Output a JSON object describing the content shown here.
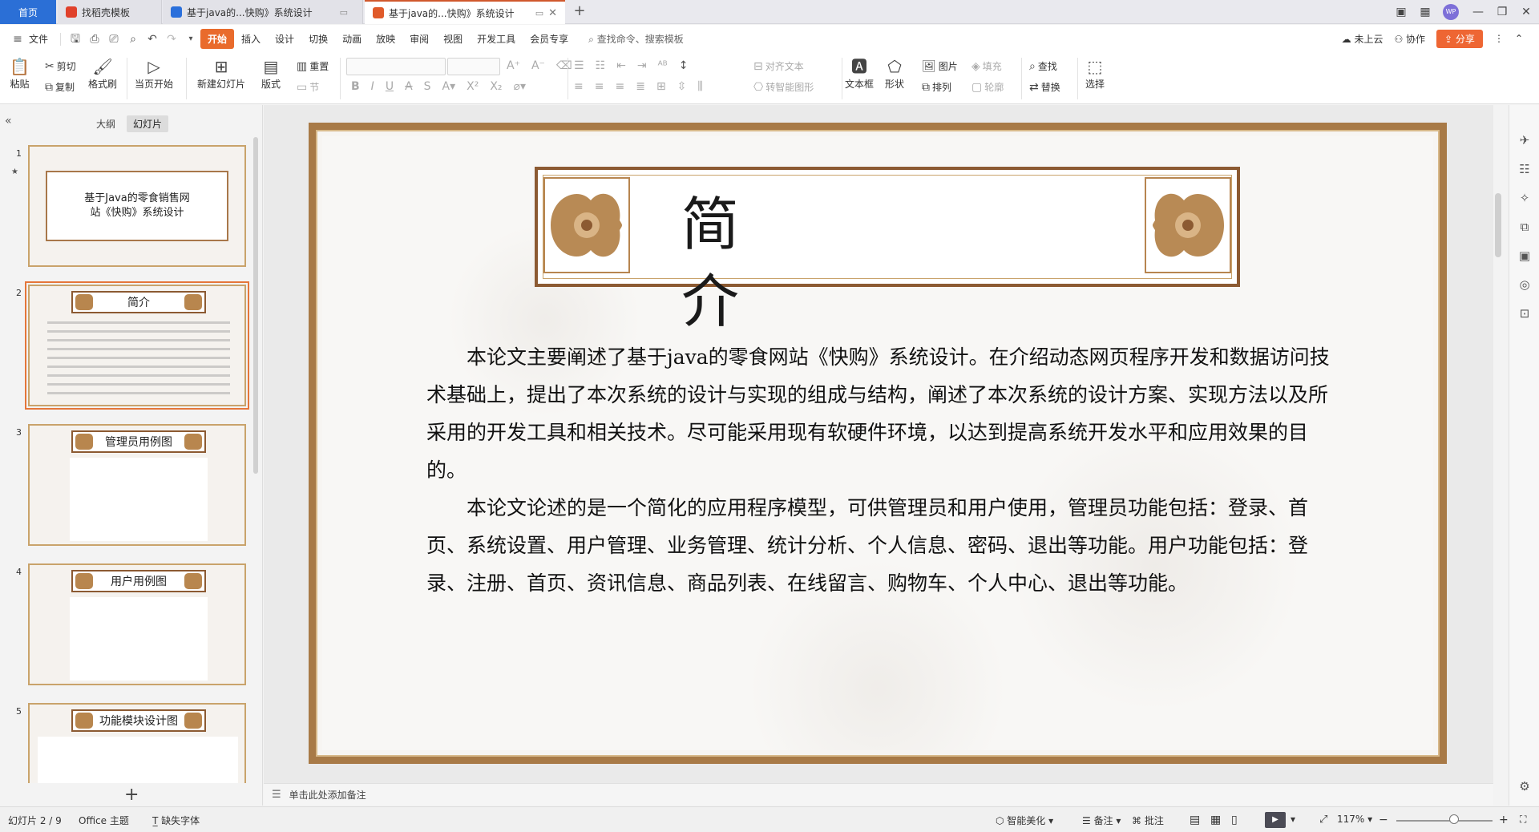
{
  "tabs": {
    "home": "首页",
    "tab1": "找稻壳模板",
    "tab2": "基于java的...快购》系统设计",
    "tab3": "基于java的...快购》系统设计"
  },
  "window": {
    "avatar": "WP"
  },
  "menu": {
    "file": "文件",
    "items": [
      "开始",
      "插入",
      "设计",
      "切换",
      "动画",
      "放映",
      "审阅",
      "视图",
      "开发工具",
      "会员专享"
    ],
    "search": "查找命令、搜索模板",
    "cloud": "未上云",
    "collab": "协作",
    "share": "分享"
  },
  "ribbon": {
    "paste": "粘贴",
    "cut": "剪切",
    "copy": "复制",
    "format_painter": "格式刷",
    "start_from_current": "当页开始",
    "new_slide": "新建幻灯片",
    "layout": "版式",
    "reset": "重置",
    "section": "节",
    "align_text": "对齐文本",
    "smart_shape": "转智能图形",
    "textbox": "文本框",
    "shape": "形状",
    "picture": "图片",
    "fill": "填充",
    "arrange": "排列",
    "outline": "轮廓",
    "find": "查找",
    "replace": "替换",
    "select": "选择"
  },
  "panel": {
    "tab_outline": "大纲",
    "tab_slides": "幻灯片",
    "slides": [
      {
        "num": "1",
        "title": "基于Java的零食销售网站《快购》系统设计"
      },
      {
        "num": "2",
        "title": "简介"
      },
      {
        "num": "3",
        "title": "管理员用例图"
      },
      {
        "num": "4",
        "title": "用户用例图"
      },
      {
        "num": "5",
        "title": "功能模块设计图"
      }
    ]
  },
  "slide": {
    "title": "简介",
    "para1": "本论文主要阐述了基于java的零食网站《快购》系统设计。在介绍动态网页程序开发和数据访问技术基础上，提出了本次系统的设计与实现的组成与结构，阐述了本次系统的设计方案、实现方法以及所采用的开发工具和相关技术。尽可能采用现有软硬件环境，以达到提高系统开发水平和应用效果的目的。",
    "para2": "本论文论述的是一个简化的应用程序模型，可供管理员和用户使用，管理员功能包括：登录、首页、系统设置、用户管理、业务管理、统计分析、个人信息、密码、退出等功能。用户功能包括：登录、注册、首页、资讯信息、商品列表、在线留言、购物车、个人中心、退出等功能。"
  },
  "notes": {
    "placeholder": "单击此处添加备注"
  },
  "status": {
    "slide_counter": "幻灯片 2 / 9",
    "theme": "Office 主题",
    "missing_font": "缺失字体",
    "smart_beautify": "智能美化",
    "notes": "备注",
    "comments": "批注",
    "zoom": "117%"
  },
  "colors": {
    "accent": "#e96b2c",
    "frame": "#a87a47",
    "home_tab": "#2b6fd6"
  }
}
